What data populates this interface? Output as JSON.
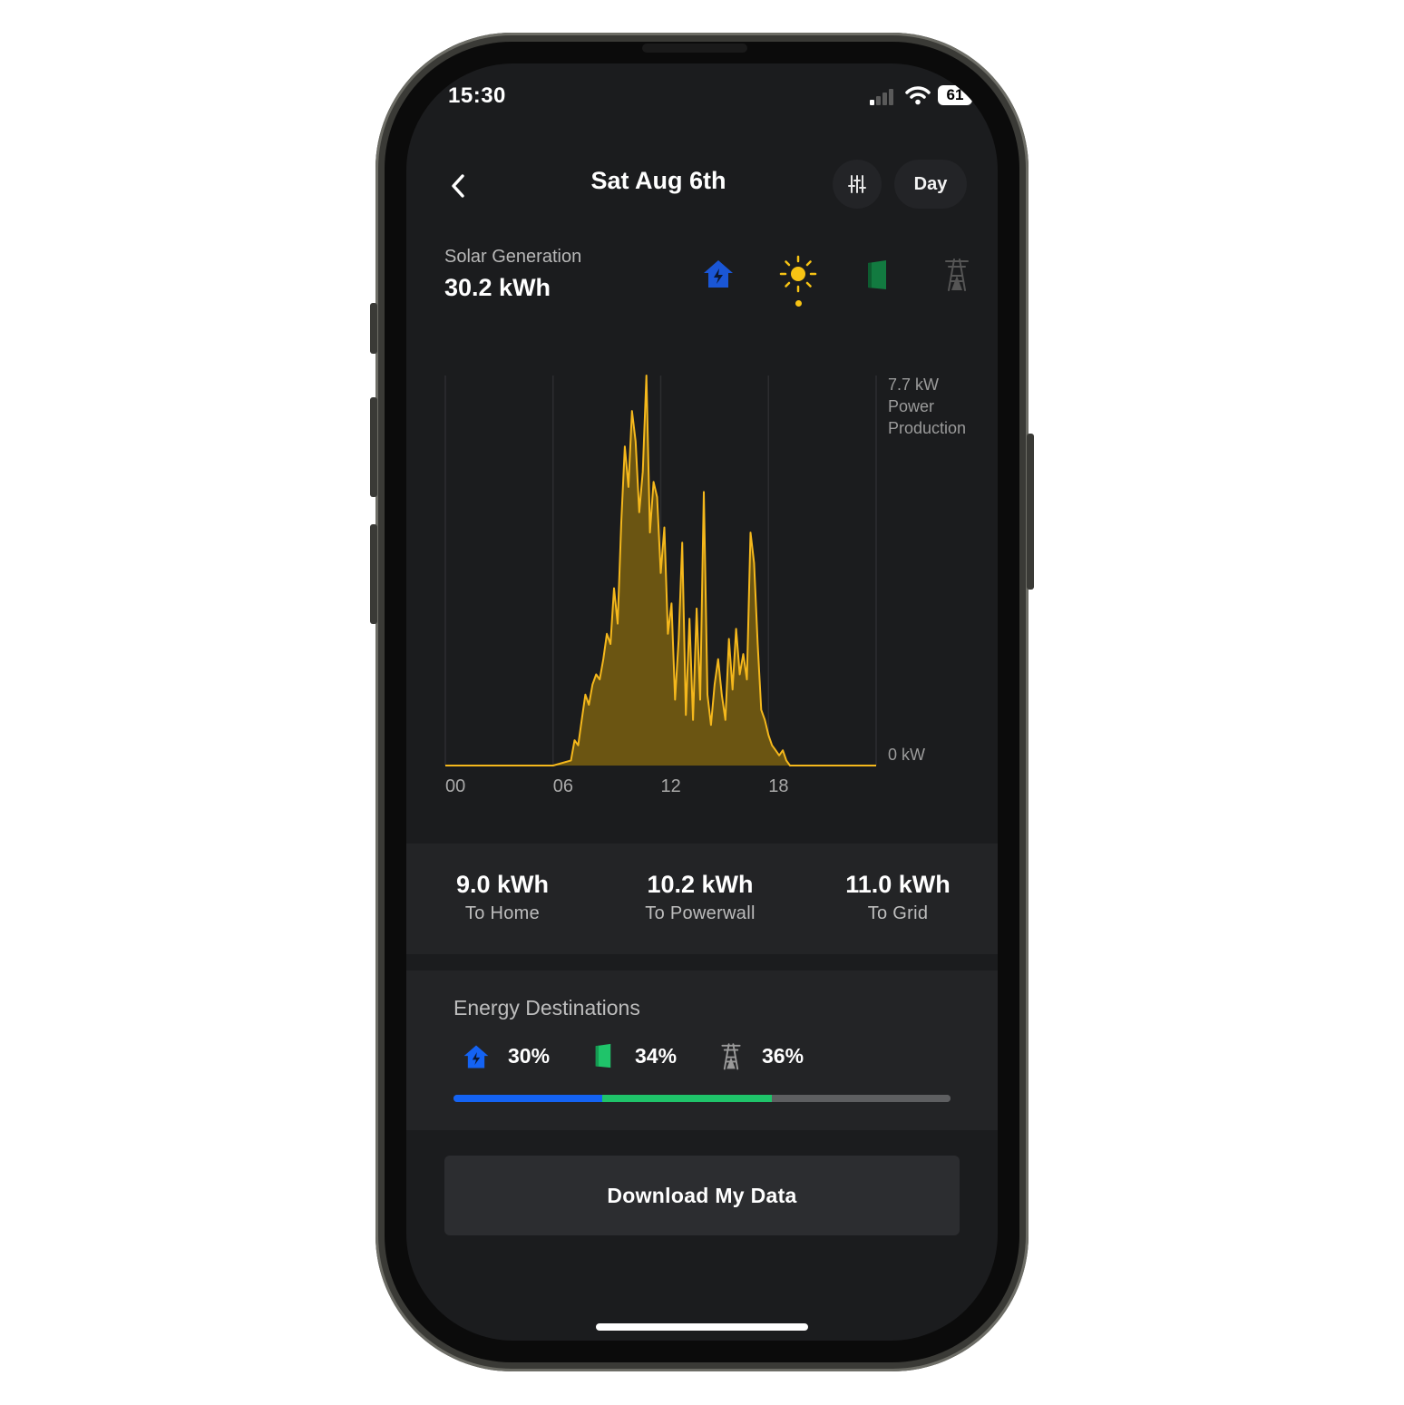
{
  "status_bar": {
    "time": "15:30",
    "battery": "61"
  },
  "header": {
    "title": "Sat Aug 6th",
    "period_button": "Day"
  },
  "summary": {
    "label": "Solar Generation",
    "value": "30.2 kWh"
  },
  "source_icons": [
    "home-icon",
    "sun-icon",
    "powerwall-icon",
    "grid-tower-icon"
  ],
  "chart_data": {
    "type": "area",
    "title": "",
    "ylabel_top": [
      "7.7 kW",
      "Power",
      "Production"
    ],
    "ylabel_bottom": "0 kW",
    "x_ticks": [
      "00",
      "06",
      "12",
      "18"
    ],
    "xlim": [
      0,
      24
    ],
    "ylim": [
      0,
      7.7
    ],
    "color": "#f5b81c",
    "fill": "#6b5512",
    "x": [
      0,
      6.0,
      7.0,
      7.2,
      7.4,
      7.6,
      7.8,
      8.0,
      8.2,
      8.4,
      8.6,
      8.8,
      9.0,
      9.2,
      9.4,
      9.6,
      9.8,
      10.0,
      10.2,
      10.4,
      10.6,
      10.8,
      11.0,
      11.2,
      11.4,
      11.6,
      11.8,
      12.0,
      12.2,
      12.4,
      12.6,
      12.8,
      13.0,
      13.2,
      13.4,
      13.6,
      13.8,
      14.0,
      14.2,
      14.4,
      14.6,
      14.8,
      15.0,
      15.2,
      15.4,
      15.6,
      15.8,
      16.0,
      16.2,
      16.4,
      16.6,
      16.8,
      17.0,
      17.2,
      17.4,
      17.6,
      17.8,
      18.0,
      18.2,
      18.4,
      18.6,
      18.8,
      19.0,
      19.2,
      19.4,
      19.6,
      19.8,
      20.0,
      24.0
    ],
    "y": [
      0,
      0,
      0.1,
      0.5,
      0.4,
      0.9,
      1.4,
      1.2,
      1.6,
      1.8,
      1.7,
      2.1,
      2.6,
      2.4,
      3.5,
      2.8,
      4.8,
      6.3,
      5.5,
      7.0,
      6.4,
      5.0,
      5.8,
      7.7,
      4.6,
      5.6,
      5.3,
      3.8,
      4.7,
      2.6,
      3.2,
      1.3,
      2.5,
      4.4,
      1.0,
      2.9,
      0.9,
      3.1,
      1.3,
      5.4,
      1.4,
      0.8,
      1.6,
      2.1,
      1.4,
      0.9,
      2.5,
      1.5,
      2.7,
      1.8,
      2.2,
      1.7,
      4.6,
      4.0,
      2.4,
      1.1,
      0.9,
      0.6,
      0.4,
      0.3,
      0.2,
      0.3,
      0.1,
      0,
      0,
      0,
      0,
      0,
      0
    ]
  },
  "totals": [
    {
      "value": "9.0 kWh",
      "label": "To Home"
    },
    {
      "value": "10.2 kWh",
      "label": "To Powerwall"
    },
    {
      "value": "11.0 kWh",
      "label": "To Grid"
    }
  ],
  "destinations": {
    "title": "Energy Destinations",
    "items": [
      {
        "icon": "home-icon",
        "percent": "30%",
        "fraction": 0.3,
        "color": "#1463f3"
      },
      {
        "icon": "powerwall-icon",
        "percent": "34%",
        "fraction": 0.34,
        "color": "#1fc46a"
      },
      {
        "icon": "grid-tower-icon",
        "percent": "36%",
        "fraction": 0.36,
        "color": "#5e5f61"
      }
    ]
  },
  "download_button": "Download My Data"
}
